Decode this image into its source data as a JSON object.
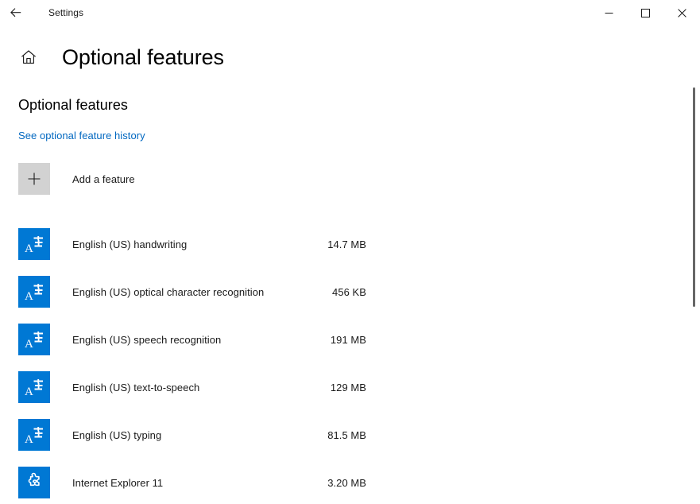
{
  "window": {
    "title": "Settings",
    "back_icon": "back-arrow-icon",
    "controls": {
      "minimize": "─",
      "maximize": "☐",
      "close": "✕"
    }
  },
  "header": {
    "home_icon": "home-icon",
    "title": "Optional features"
  },
  "main": {
    "section_heading": "Optional features",
    "history_link": "See optional feature history",
    "add_feature": {
      "label": "Add a feature",
      "icon": "plus-icon"
    },
    "features": [
      {
        "name": "English (US) handwriting",
        "size": "14.7 MB",
        "icon": "language-icon"
      },
      {
        "name": "English (US) optical character recognition",
        "size": "456 KB",
        "icon": "language-icon"
      },
      {
        "name": "English (US) speech recognition",
        "size": "191 MB",
        "icon": "language-icon"
      },
      {
        "name": "English (US) text-to-speech",
        "size": "129 MB",
        "icon": "language-icon"
      },
      {
        "name": "English (US) typing",
        "size": "81.5 MB",
        "icon": "language-icon"
      },
      {
        "name": "Internet Explorer 11",
        "size": "3.20 MB",
        "icon": "puzzle-piece-icon"
      }
    ]
  },
  "colors": {
    "accent": "#0078d4",
    "link": "#0067c0",
    "add_box": "#d2d2d2",
    "scrollbar": "#676767"
  }
}
